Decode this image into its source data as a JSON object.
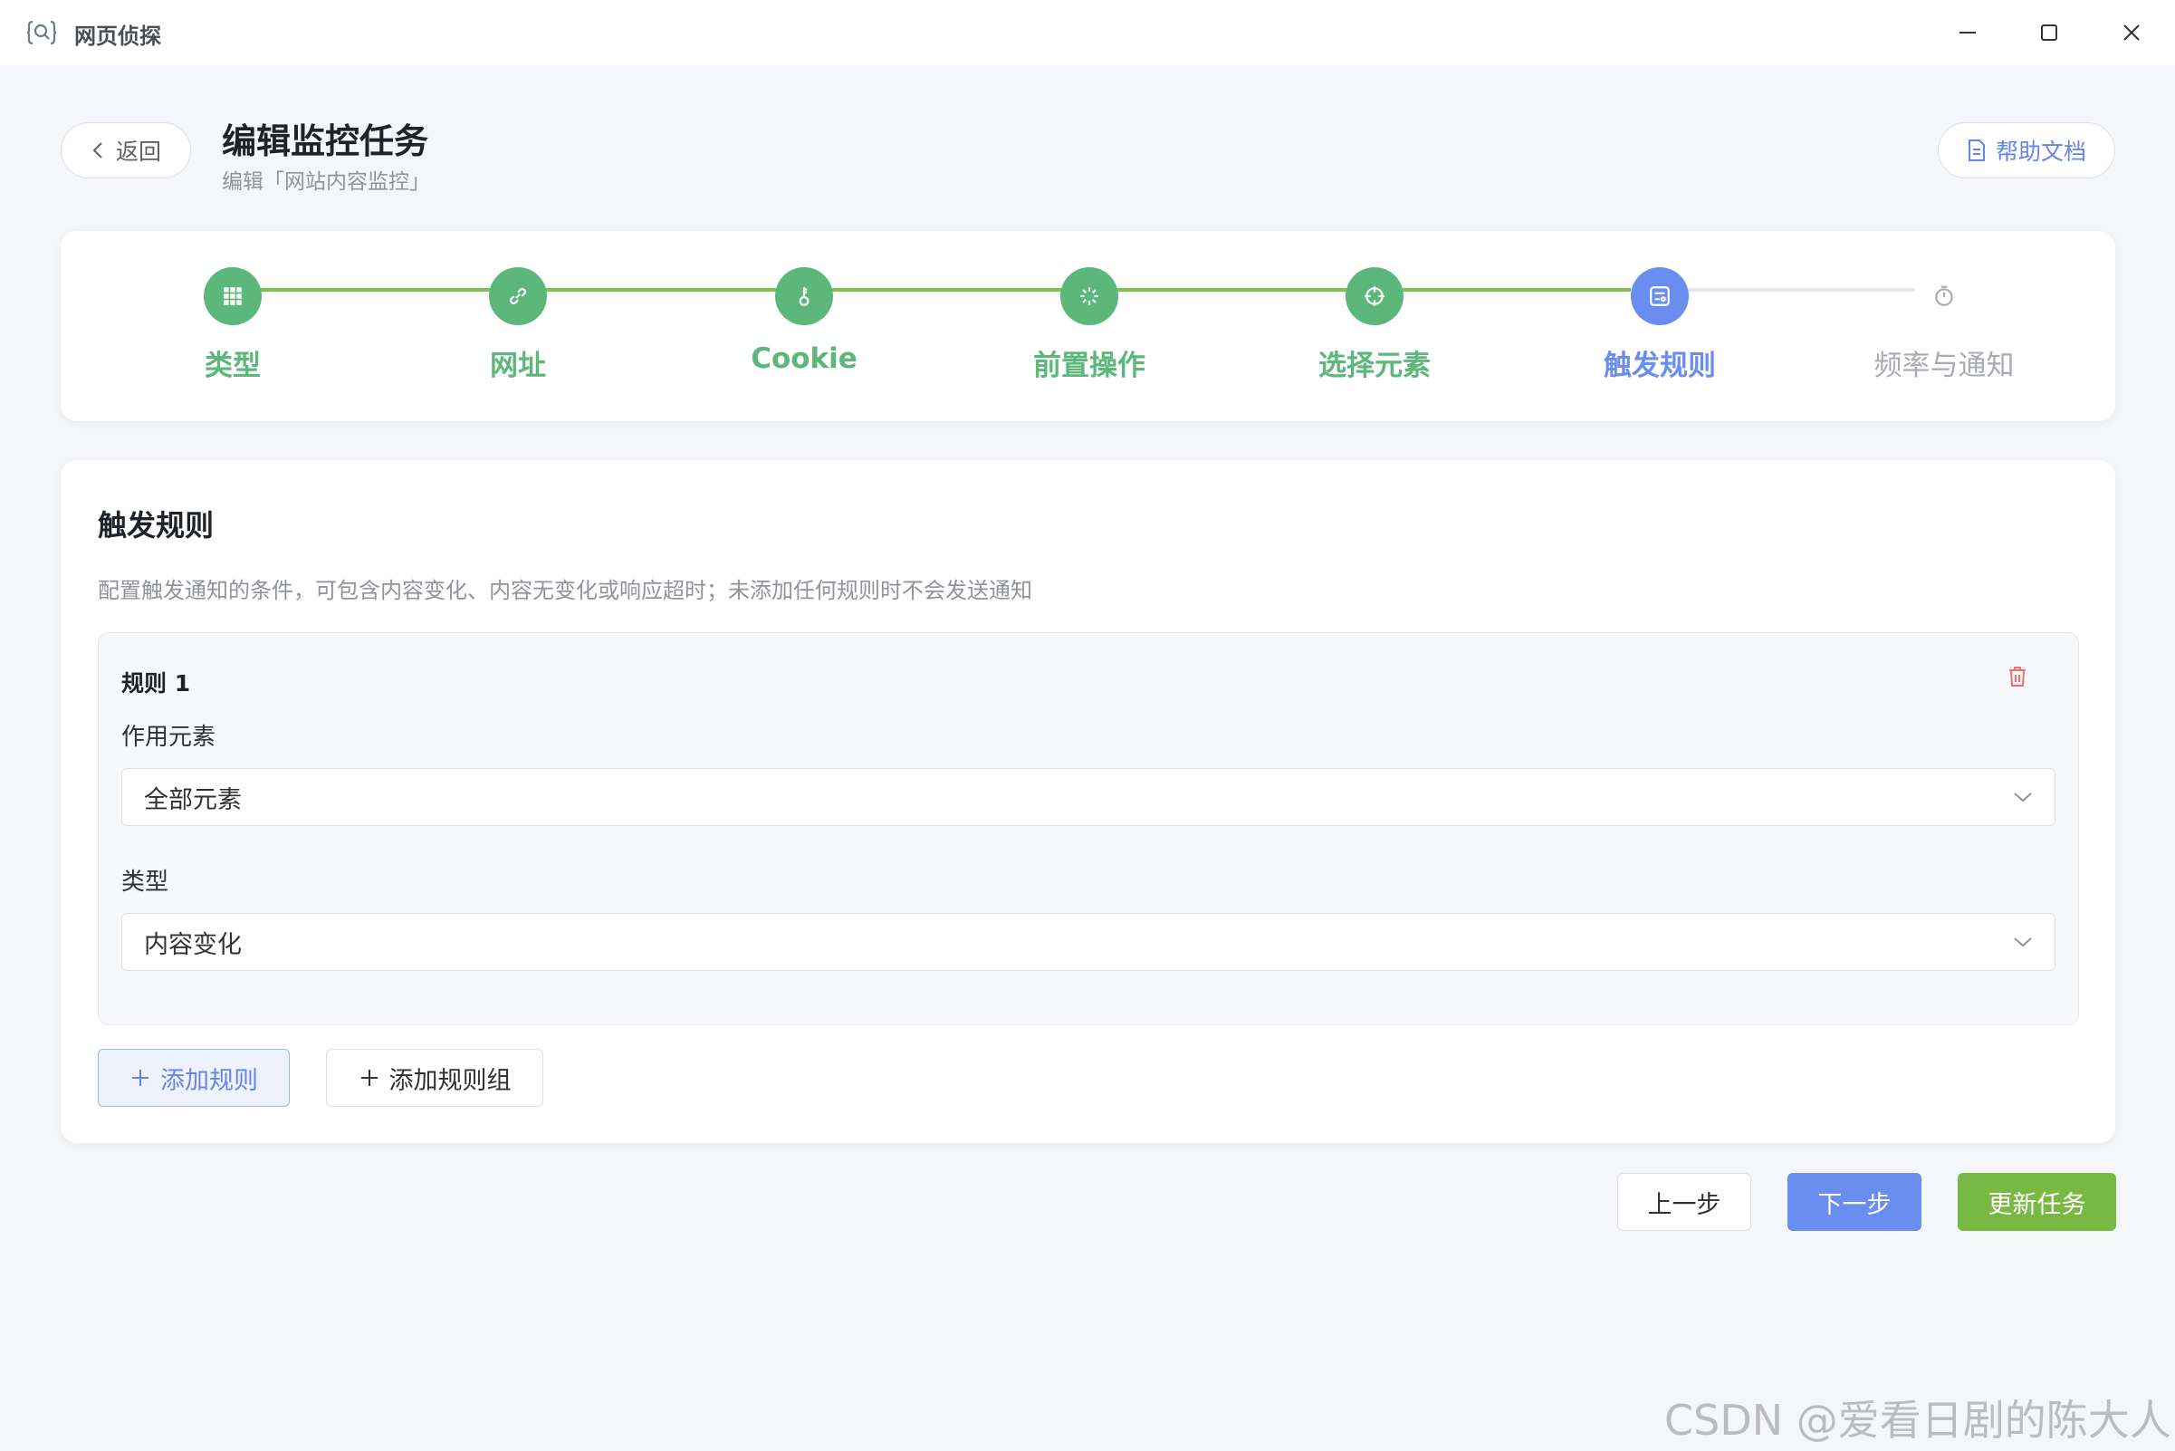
{
  "app": {
    "title": "网页侦探",
    "logo_icon": "search-bracket-icon"
  },
  "window_controls": [
    "minimize-icon",
    "maximize-icon",
    "close-icon"
  ],
  "header": {
    "back_label": "返回",
    "title": "编辑监控任务",
    "subtitle": "编辑「网站内容监控」",
    "help_label": "帮助文档"
  },
  "steps": [
    {
      "label": "类型",
      "icon": "grid-icon",
      "state": "done"
    },
    {
      "label": "网址",
      "icon": "link-icon",
      "state": "done"
    },
    {
      "label": "Cookie",
      "icon": "key-icon",
      "state": "done"
    },
    {
      "label": "前置操作",
      "icon": "loading-icon",
      "state": "done"
    },
    {
      "label": "选择元素",
      "icon": "crosshair-icon",
      "state": "done"
    },
    {
      "label": "触发规则",
      "icon": "rule-icon",
      "state": "active"
    },
    {
      "label": "频率与通知",
      "icon": "timer-icon",
      "state": "pending"
    }
  ],
  "colors": {
    "done": "#5cb87a",
    "active": "#6a8ef0",
    "pending": "#a8abb2",
    "update": "#78b944",
    "danger": "#f56c6c"
  },
  "section": {
    "title": "触发规则",
    "description": "配置触发通知的条件，可包含内容变化、内容无变化或响应超时；未添加任何规则时不会发送通知"
  },
  "rules": [
    {
      "title": "规则 1",
      "element_label": "作用元素",
      "element_value": "全部元素",
      "type_label": "类型",
      "type_value": "内容变化"
    }
  ],
  "actions": {
    "add_rule": "添加规则",
    "add_rule_group": "添加规则组",
    "prev": "上一步",
    "next": "下一步",
    "update": "更新任务"
  },
  "watermark": "CSDN @爱看日剧的陈大人"
}
